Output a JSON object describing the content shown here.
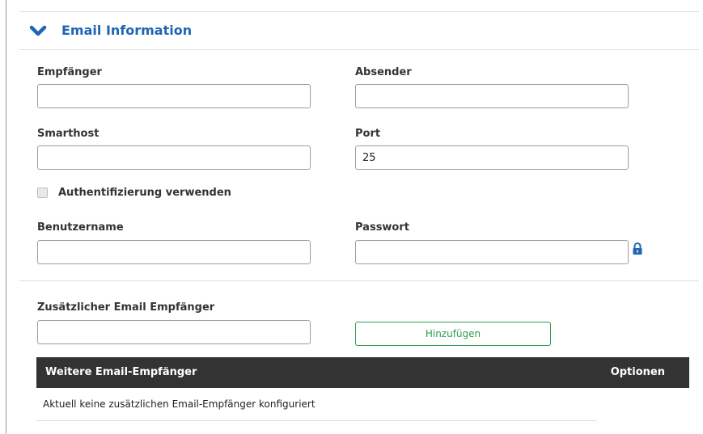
{
  "section": {
    "title": "Email Information",
    "toggle_icon": "chevron-down-icon",
    "accent_color": "#1f65b5"
  },
  "fields": {
    "recipient": {
      "label": "Empfänger",
      "value": ""
    },
    "sender": {
      "label": "Absender",
      "value": ""
    },
    "smarthost": {
      "label": "Smarthost",
      "value": ""
    },
    "port": {
      "label": "Port",
      "value": "25"
    },
    "use_auth": {
      "label": "Authentifizierung verwenden",
      "checked": false
    },
    "username": {
      "label": "Benutzername",
      "value": ""
    },
    "password": {
      "label": "Passwort",
      "value": "",
      "icon": "lock-icon",
      "icon_color": "#1f65b5"
    }
  },
  "additional": {
    "label": "Zusätzlicher Email Empfänger",
    "value": "",
    "add_button": "Hinzufügen",
    "button_color": "#2e9e4a"
  },
  "table": {
    "headers": [
      "Weitere Email-Empfänger",
      "Optionen"
    ],
    "empty_message": "Aktuell keine zusätzlichen Email-Empfänger konfiguriert",
    "header_bg": "#333333"
  }
}
